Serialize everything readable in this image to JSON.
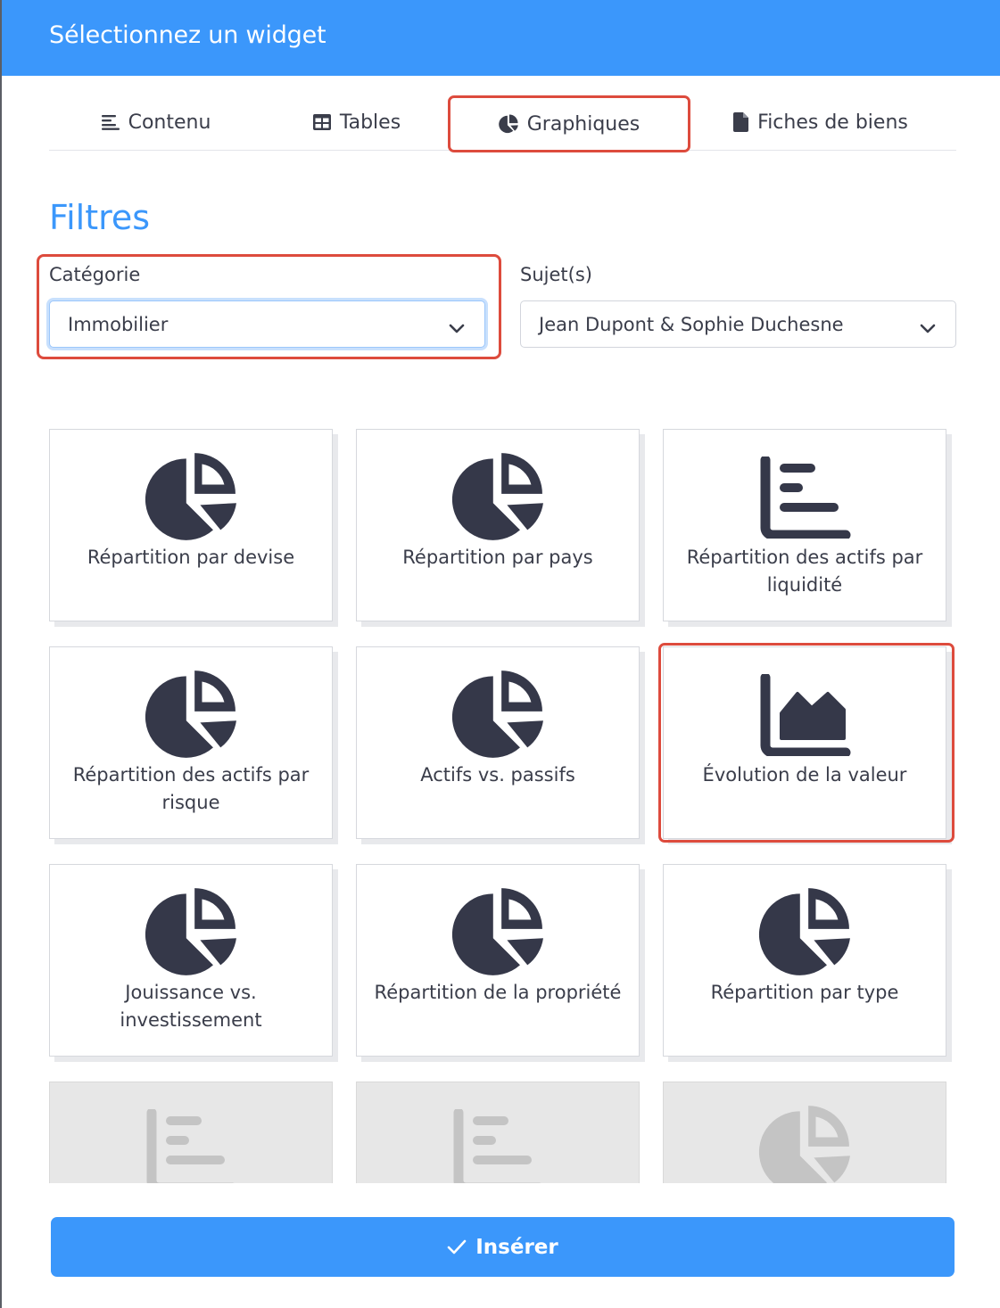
{
  "header": {
    "title": "Sélectionnez un widget"
  },
  "tabs": [
    {
      "label": "Contenu",
      "icon": "align-left-icon"
    },
    {
      "label": "Tables",
      "icon": "table-icon"
    },
    {
      "label": "Graphiques",
      "icon": "pie-chart-icon",
      "active": true
    },
    {
      "label": "Fiches de biens",
      "icon": "file-icon"
    }
  ],
  "filters": {
    "title": "Filtres",
    "categorie": {
      "label": "Catégorie",
      "value": "Immobilier"
    },
    "sujets": {
      "label": "Sujet(s)",
      "value": "Jean Dupont & Sophie Duchesne"
    }
  },
  "widgets": [
    {
      "label": "Répartition par devise",
      "icon": "pie-chart-icon"
    },
    {
      "label": "Répartition par pays",
      "icon": "pie-chart-icon"
    },
    {
      "label": "Répartition des actifs par liquidité",
      "icon": "bar-chart-icon"
    },
    {
      "label": "Répartition des actifs par risque",
      "icon": "pie-chart-icon"
    },
    {
      "label": "Actifs vs. passifs",
      "icon": "pie-chart-icon"
    },
    {
      "label": "Évolution de la valeur",
      "icon": "area-chart-icon",
      "selected": true
    },
    {
      "label": "Jouissance vs. investissement",
      "icon": "pie-chart-icon"
    },
    {
      "label": "Répartition de la propriété",
      "icon": "pie-chart-icon"
    },
    {
      "label": "Répartition par type",
      "icon": "pie-chart-icon"
    },
    {
      "label": "",
      "icon": "bar-chart-icon",
      "disabled": true
    },
    {
      "label": "",
      "icon": "bar-chart-icon",
      "disabled": true
    },
    {
      "label": "",
      "icon": "pie-chart-icon",
      "disabled": true
    }
  ],
  "insert_button": {
    "label": "Insérer"
  },
  "colors": {
    "accent": "#3b97fb",
    "highlight": "#dd4b3d",
    "icon": "#353849"
  }
}
